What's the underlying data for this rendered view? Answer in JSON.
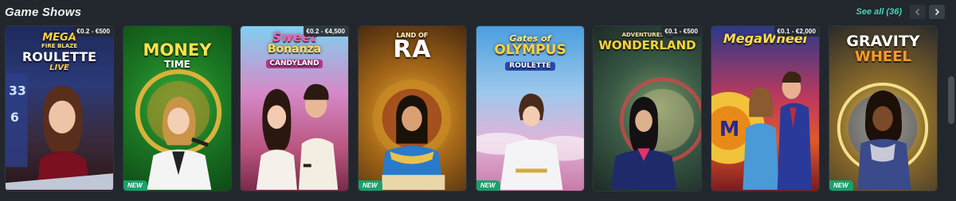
{
  "section": {
    "title": "Game Shows",
    "see_all_label": "See all (36)"
  },
  "icons": {
    "prev": "chevron-left-icon",
    "next": "chevron-right-icon"
  },
  "colors": {
    "background": "#22272d",
    "accent": "#3fd6b8",
    "new_badge": "#1aa06c"
  },
  "games": [
    {
      "logo_line1": "MEGA",
      "logo_line1b": "FIRE BLAZE",
      "logo_line2": "ROULETTE",
      "logo_line3": "LIVE",
      "stake": "€0.2 - €500",
      "new": ""
    },
    {
      "logo_line1": "MONEY",
      "logo_line2": "TIME",
      "stake": "",
      "new": "NEW"
    },
    {
      "logo_line1": "Sweet",
      "logo_line2": "Bonanza",
      "logo_line3": "CANDYLAND",
      "stake": "€0.2 - €4,500",
      "new": ""
    },
    {
      "logo_line1": "LAND OF",
      "logo_line2": "RA",
      "stake": "",
      "new": "NEW"
    },
    {
      "logo_line1": "Gates of",
      "logo_line2": "OLYMPUS",
      "logo_line3": "ROULETTE",
      "stake": "",
      "new": "NEW"
    },
    {
      "logo_line1": "ADVENTURES IN",
      "logo_line2": "WONDERLAND",
      "stake": "€0.1 - €500",
      "new": ""
    },
    {
      "logo_line1": "MegaWheel",
      "stake": "€0.1 - €2,000",
      "new": ""
    },
    {
      "logo_line1": "GRAVITY",
      "logo_line2": "WHEEL",
      "stake": "",
      "new": "NEW"
    }
  ]
}
